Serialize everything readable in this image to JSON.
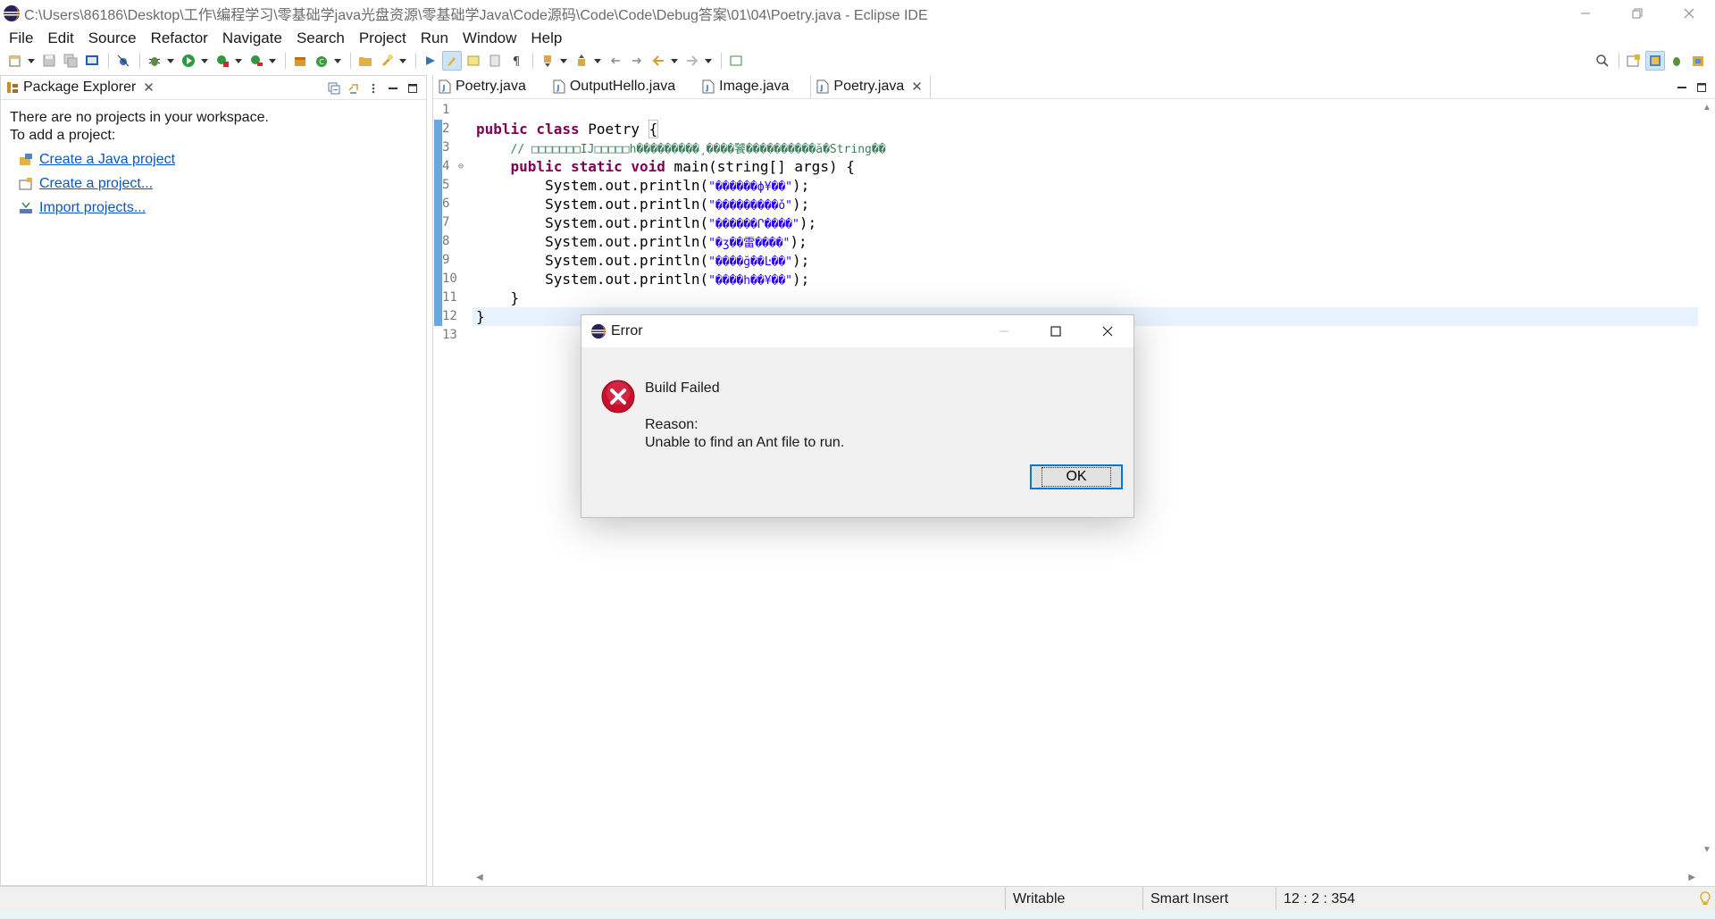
{
  "window": {
    "title": "C:\\Users\\86186\\Desktop\\工作\\编程学习\\零基础学java光盘资源\\零基础学Java\\Code源码\\Code\\Code\\Debug答案\\01\\04\\Poetry.java - Eclipse IDE",
    "icon": "eclipse-icon"
  },
  "menu": [
    "File",
    "Edit",
    "Source",
    "Refactor",
    "Navigate",
    "Search",
    "Project",
    "Run",
    "Window",
    "Help"
  ],
  "package_explorer": {
    "tab_label": "Package Explorer",
    "message_line1": "There are no projects in your workspace.",
    "message_line2": "To add a project:",
    "links": [
      "Create a Java project",
      "Create a project...",
      "Import projects..."
    ]
  },
  "editor": {
    "tabs": [
      {
        "label": "Poetry.java",
        "active": false
      },
      {
        "label": "OutputHello.java",
        "active": false
      },
      {
        "label": "Image.java",
        "active": false
      },
      {
        "label": "Poetry.java",
        "active": true
      }
    ],
    "line_numbers": [
      "1",
      "2",
      "3",
      "4",
      "5",
      "6",
      "7",
      "8",
      "9",
      "10",
      "11",
      "12",
      "13"
    ],
    "code": {
      "l2_kw": "public class",
      "l2_name": " Poetry ",
      "l2_brace": "{",
      "l3_comment": "// □□□□□□□IJ□□□□□h���������¸����饕����������ă�String��",
      "l4_kw": "public static void",
      "l4_rest": " main(string[] args) {",
      "print_prefix": "System.out.println(",
      "print_suffix": ");",
      "strings": [
        "\"������ф¥��\"",
        "\"���������ǒ\"",
        "\"������Ր����\"",
        "\"�ʒ��雷����\"",
        "\"����ğ��Ŀ��\"",
        "\"����h��¥��\""
      ],
      "l11": "}",
      "l12": "}"
    }
  },
  "status": {
    "writable": "Writable",
    "insert_mode": "Smart Insert",
    "position": "12 : 2 : 354"
  },
  "dialog": {
    "title": "Error",
    "heading": "Build Failed",
    "reason_label": "Reason:",
    "reason_text": "Unable to find an Ant file to run.",
    "ok_label": "OK"
  },
  "colors": {
    "keyword": "#7f0055",
    "comment": "#3f7f5f",
    "string": "#2a00ff",
    "link": "#0b57c3",
    "current_line": "#e8f2fe",
    "error_red": "#c8102e",
    "focus_blue": "#0078d7"
  }
}
